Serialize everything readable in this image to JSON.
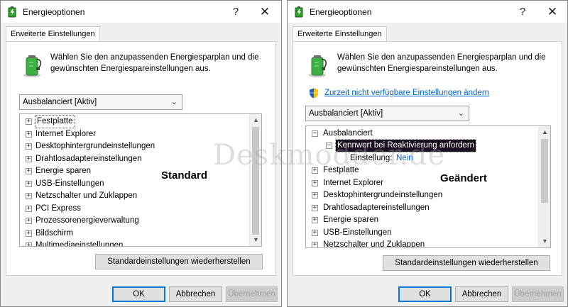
{
  "watermark": "Deskmodder.de",
  "colors": {
    "accent": "#0078d7",
    "selection": "#1a0f1f",
    "link": "#0066cc"
  },
  "left": {
    "window_title": "Energieoptionen",
    "help_symbol": "?",
    "close_symbol": "✕",
    "tab_label": "Erweiterte Einstellungen",
    "intro_line1": "Wählen Sie den anzupassenden Energiesparplan und die",
    "intro_line2": "gewünschten Energiespareinstellungen aus.",
    "plan_select_value": "Ausbalanciert [Aktiv]",
    "caption": "Standard",
    "tree_items": [
      {
        "label": "Festplatte",
        "selected": true
      },
      {
        "label": "Internet Explorer"
      },
      {
        "label": "Desktophintergrundeinstellungen"
      },
      {
        "label": "Drahtlosadaptereinstellungen"
      },
      {
        "label": "Energie sparen"
      },
      {
        "label": "USB-Einstellungen"
      },
      {
        "label": "Netzschalter und Zuklappen"
      },
      {
        "label": "PCI Express"
      },
      {
        "label": "Prozessorenergieverwaltung"
      },
      {
        "label": "Bildschirm"
      },
      {
        "label": "Multimediaeinstellungen"
      }
    ],
    "restore_button": "Standardeinstellungen wiederherstellen",
    "ok_button": "OK",
    "cancel_button": "Abbrechen",
    "apply_button": "Übernehmen"
  },
  "right": {
    "window_title": "Energieoptionen",
    "help_symbol": "?",
    "close_symbol": "✕",
    "tab_label": "Erweiterte Einstellungen",
    "intro_line1": "Wählen Sie den anzupassenden Energiesparplan und die",
    "intro_line2": "gewünschten Energiespareinstellungen aus.",
    "change_settings_link": "Zurzeit nicht verfügbare Einstellungen ändern",
    "plan_select_value": "Ausbalanciert [Aktiv]",
    "caption": "Geändert",
    "tree_root": "Ausbalanciert",
    "tree_child": "Kennwort bei Reaktivierung anfordern",
    "setting_label": "Einstellung:",
    "setting_value": "Nein",
    "tree_items": [
      {
        "label": "Festplatte"
      },
      {
        "label": "Internet Explorer"
      },
      {
        "label": "Desktophintergrundeinstellungen"
      },
      {
        "label": "Drahtlosadaptereinstellungen"
      },
      {
        "label": "Energie sparen"
      },
      {
        "label": "USB-Einstellungen"
      },
      {
        "label": "Netzschalter und Zuklappen"
      }
    ],
    "restore_button": "Standardeinstellungen wiederherstellen",
    "ok_button": "OK",
    "cancel_button": "Abbrechen",
    "apply_button": "Übernehmen"
  },
  "icons": {
    "battery": "battery-power-icon",
    "expand": "plus-expander-icon",
    "collapse": "minus-expander-icon",
    "shield": "uac-shield-icon",
    "scroll_up": "scroll-up-arrow-icon",
    "scroll_down": "scroll-down-arrow-icon",
    "dropdown": "chevron-down-icon"
  }
}
